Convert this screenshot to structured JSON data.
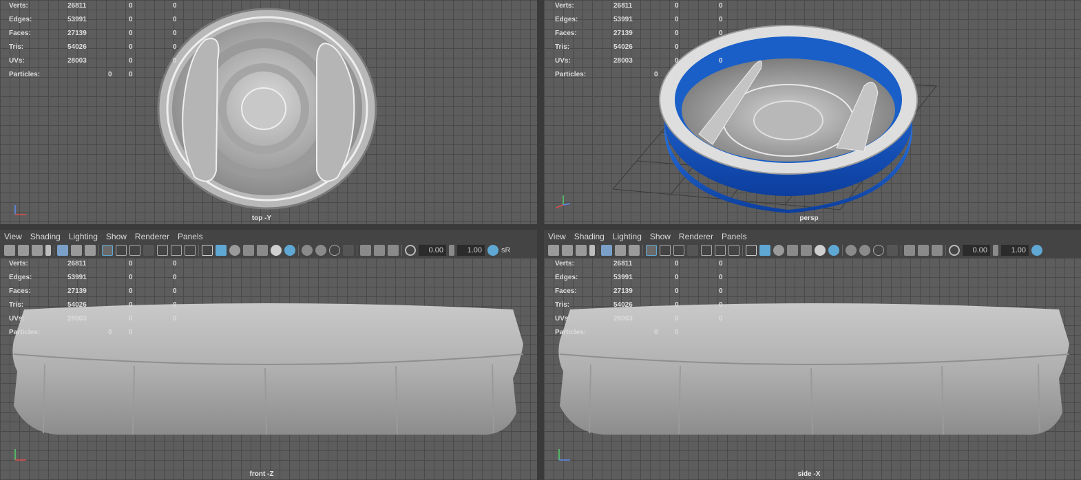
{
  "colors": {
    "viewport_bg": "#5d5d5d",
    "grid": "#4a4a4a",
    "accent": "#5fa8d3",
    "mesh_blue": "#1a5fc8"
  },
  "hud": {
    "rows": [
      {
        "label": "Verts:",
        "v1": "26811",
        "v2": "0",
        "v3": "0"
      },
      {
        "label": "Edges:",
        "v1": "53991",
        "v2": "0",
        "v3": "0"
      },
      {
        "label": "Faces:",
        "v1": "27139",
        "v2": "0",
        "v3": "0"
      },
      {
        "label": "Tris:",
        "v1": "54026",
        "v2": "0",
        "v3": "0"
      },
      {
        "label": "UVs:",
        "v1": "28003",
        "v2": "0",
        "v3": "0"
      }
    ],
    "particles": {
      "label": "Particles:",
      "v1": "0",
      "v2": "0"
    }
  },
  "viewports": {
    "top": {
      "label": "top -Y"
    },
    "persp": {
      "label": "persp"
    },
    "front": {
      "label": "front -Z"
    },
    "side": {
      "label": "side -X"
    }
  },
  "menu": {
    "view": "View",
    "shading": "Shading",
    "lighting": "Lighting",
    "show": "Show",
    "renderer": "Renderer",
    "panels": "Panels"
  },
  "toolbar": {
    "field1": "0.00",
    "field2": "1.00",
    "srgb": "sR"
  },
  "icons": [
    "camera-icon",
    "select-camera-icon",
    "lock-camera-icon",
    "bookmark-icon",
    "grid-icon",
    "wireframe-icon",
    "smooth-shade-icon",
    "texture-icon",
    "light-icon",
    "isolate-icon",
    "xray-icon",
    "exposure-icon",
    "gamma-icon",
    "color-manage-icon"
  ]
}
